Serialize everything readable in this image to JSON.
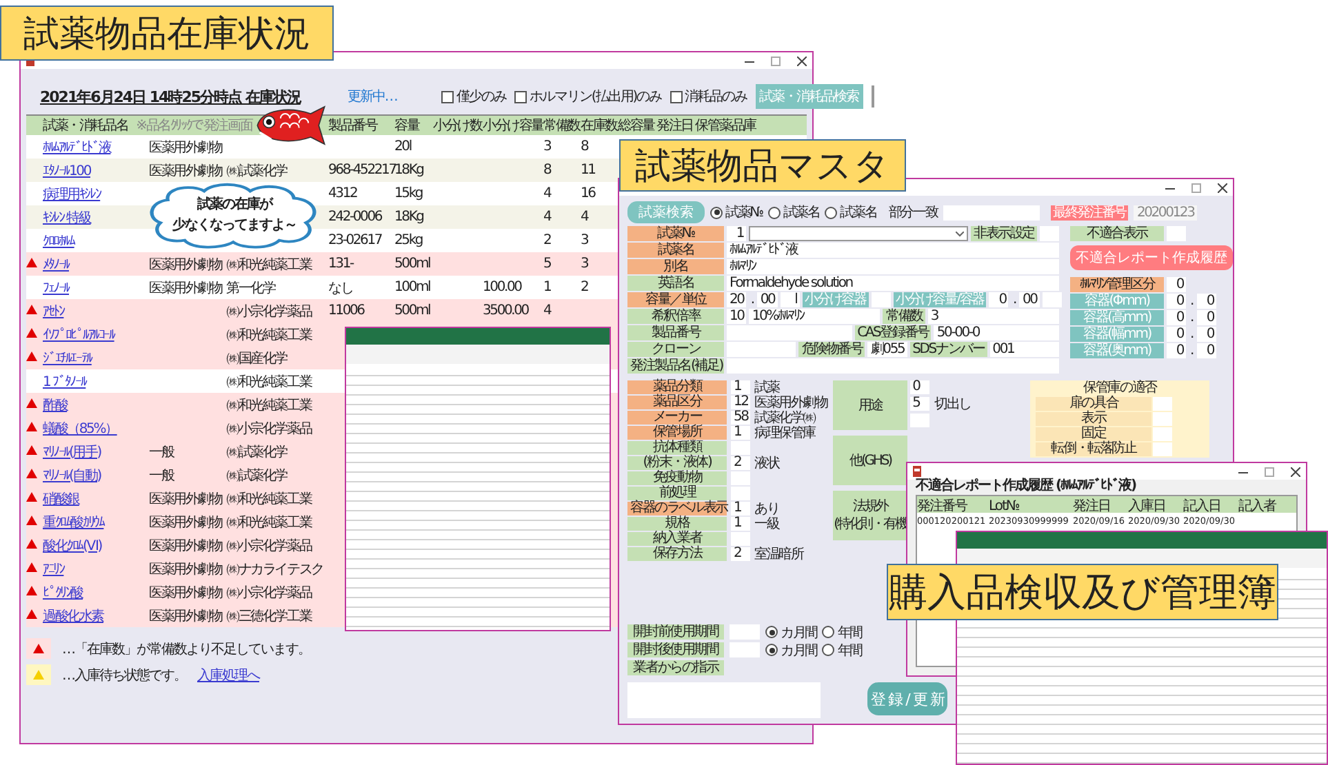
{
  "banners": [
    "試薬物品在庫状況",
    "試薬物品マスタ",
    "購入品検収及び管理簿"
  ],
  "stock_window": {
    "title": "2021年6月24日 14時25分時点 在庫状況",
    "status": "更新中…",
    "filters": [
      {
        "label": "僅少のみ",
        "checked": false
      },
      {
        "label": "ホルマリン(払出用)のみ",
        "checked": false
      },
      {
        "label": "消耗品のみ",
        "checked": false
      }
    ],
    "search_button": "試薬・消耗品検索",
    "name_header": "試薬・消耗品名",
    "name_hint": "※品名ｸﾘｯｸで発注画面",
    "columns": [
      "製品番号",
      "容量",
      "小分け数",
      "小分け容量",
      "常備数",
      "在庫数",
      "総容量",
      "発注日",
      "保管薬品庫"
    ],
    "rows": [
      {
        "warn": false,
        "name": "ﾎﾙﾑｱﾙﾃﾞﾋﾄﾞ液",
        "category": "医薬用外劇物",
        "volume": "20l",
        "standing": "3",
        "stock": "8"
      },
      {
        "warn": false,
        "name": "ｴﾀﾉｰﾙ100",
        "category": "医薬用外劇物",
        "maker": "㈱試薬化学",
        "product_no": "968-452217",
        "volume": "18Kg",
        "standing": "8",
        "stock": "11"
      },
      {
        "warn": false,
        "name": "病理用ｷｼﾚﾝ",
        "product_no": "4312",
        "volume": "15kg",
        "standing": "4",
        "stock": "16"
      },
      {
        "warn": false,
        "name": "ｷｼﾚﾝ 特級",
        "product_no": "242-0006",
        "volume": "18Kg",
        "standing": "4",
        "stock": "4"
      },
      {
        "warn": false,
        "name": "ｸﾛﾛﾎﾙﾑ",
        "product_no": "23-02617",
        "volume": "25kg",
        "standing": "2",
        "stock": "3"
      },
      {
        "warn": true,
        "name": "ﾒﾀﾉｰﾙ",
        "category": "医薬用外劇物",
        "maker": "㈱和光純薬工業",
        "product_no": "131-",
        "volume": "500ml",
        "standing": "5",
        "stock": "3"
      },
      {
        "warn": false,
        "name": "ﾌｪﾉｰﾙ",
        "category": "医薬用外劇物",
        "maker": "第一化学",
        "product_no": "なし",
        "volume": "100ml",
        "sub_volume": "100.00",
        "standing": "1",
        "stock": "2"
      },
      {
        "warn": true,
        "name": "ｱｾﾄﾝ",
        "maker": "㈱小宗化学薬品",
        "product_no": "11006",
        "volume": "500ml",
        "sub_volume": "3500.00",
        "standing": "4"
      },
      {
        "warn": true,
        "name": "ｲｿﾌﾟﾛﾋﾟﾙｱﾙｺｰﾙ",
        "maker": "㈱和光純薬工業"
      },
      {
        "warn": true,
        "name": "ｼﾞｴﾁﾙｴｰﾃﾙ",
        "maker": "㈱国産化学"
      },
      {
        "warn": false,
        "name": "1 ﾌﾞﾀﾉｰﾙ",
        "maker": "㈱和光純薬工業"
      },
      {
        "warn": true,
        "name": "酢酸",
        "maker": "㈱和光純薬工業"
      },
      {
        "warn": true,
        "name": "蟻酸（85%）",
        "maker": "㈱小宗化学薬品"
      },
      {
        "warn": true,
        "name": "ﾏﾘﾉｰﾙ(用手)",
        "category": "一般",
        "maker": "㈱試薬化学"
      },
      {
        "warn": true,
        "name": "ﾏﾘﾉｰﾙ(自動)",
        "category": "一般",
        "maker": "㈱試薬化学"
      },
      {
        "warn": true,
        "name": "硝酸銀",
        "category": "医薬用外劇物",
        "maker": "㈱和光純薬工業"
      },
      {
        "warn": true,
        "name": "重ｸﾛﾑ酸ｶﾘｳﾑ",
        "category": "医薬用外劇物",
        "maker": "㈱和光純薬工業"
      },
      {
        "warn": true,
        "name": "酸化ｸﾛﾑ(Ⅵ)",
        "category": "医薬用外劇物",
        "maker": "㈱小宗化学薬品"
      },
      {
        "warn": true,
        "name": "ｱﾆﾘﾝ",
        "category": "医薬用外劇物",
        "maker": "㈱ナカライテスク"
      },
      {
        "warn": true,
        "name": "ﾋﾟｸﾘﾝ酸",
        "category": "医薬用外劇物",
        "maker": "㈱小宗化学薬品"
      },
      {
        "warn": true,
        "name": "過酸化水素",
        "category": "医薬用外劇物",
        "maker": "㈱三徳化学工業"
      }
    ],
    "legend": [
      {
        "kind": "shortage",
        "text": "…「在庫数」が常備数より不足しています。"
      },
      {
        "kind": "waiting",
        "text": "…入庫待ち状態です。",
        "link": "入庫処理へ"
      }
    ]
  },
  "balloon": [
    "試薬の在庫が",
    "少なくなってますよ～"
  ],
  "master_window": {
    "search_button": "試薬検索",
    "search_options": [
      {
        "label": "試薬№",
        "selected": true
      },
      {
        "label": "試薬名",
        "selected": false
      },
      {
        "label": "試薬名　部分一致",
        "selected": false
      }
    ],
    "last_order_label": "最終発注番号",
    "last_order": "20200123",
    "left_rows": [
      {
        "items": [
          {
            "kind": "label",
            "text": "試薬№",
            "color": "#f4b183"
          },
          {
            "kind": "num",
            "text": "1"
          },
          {
            "kind": "dropdown"
          },
          {
            "kind": "tag",
            "text": "非表示設定",
            "color": "#c5e0b4"
          },
          {
            "kind": "num"
          }
        ]
      },
      {
        "items": [
          {
            "kind": "label",
            "text": "試薬名",
            "color": "#f4b183"
          },
          {
            "kind": "text",
            "text": "ﾎﾙﾑｱﾙﾃﾞﾋﾄﾞ液"
          }
        ]
      },
      {
        "items": [
          {
            "kind": "label",
            "text": "別名",
            "color": "#f4b183"
          },
          {
            "kind": "text",
            "text": "ﾎﾙﾏﾘﾝ"
          }
        ]
      },
      {
        "items": [
          {
            "kind": "label",
            "text": "英語名",
            "color": "#c5e0b4"
          },
          {
            "kind": "text",
            "text": "Formaldehyde solution"
          }
        ]
      },
      {
        "items": [
          {
            "kind": "label",
            "text": "容量／単位",
            "color": "#f4b183"
          },
          {
            "kind": "num",
            "text": "20"
          },
          {
            "kind": "sep",
            "text": "."
          },
          {
            "kind": "num",
            "text": "00"
          },
          {
            "kind": "num",
            "text": "l"
          },
          {
            "kind": "tag",
            "text": "小分け容器",
            "color": "#7fc4c0"
          },
          {
            "kind": "num"
          },
          {
            "kind": "tag",
            "text": "小分け容量/容器",
            "color": "#7fc4c0"
          },
          {
            "kind": "num",
            "text": "0"
          },
          {
            "kind": "sep",
            "text": "."
          },
          {
            "kind": "num",
            "text": "00"
          },
          {
            "kind": "num"
          }
        ]
      },
      {
        "items": [
          {
            "kind": "label",
            "text": "希釈倍率",
            "color": "#c5e0b4"
          },
          {
            "kind": "num",
            "text": "10"
          },
          {
            "kind": "text",
            "text": "10%ﾎﾙﾏﾘﾝ"
          },
          {
            "kind": "tag",
            "text": "常備数",
            "color": "#c5e0b4"
          },
          {
            "kind": "text",
            "text": "3"
          }
        ]
      },
      {
        "items": [
          {
            "kind": "label",
            "text": "製品番号",
            "color": "#c5e0b4"
          },
          {
            "kind": "text"
          },
          {
            "kind": "tag",
            "text": "CAS登録番号",
            "color": "#c5e0b4"
          },
          {
            "kind": "text",
            "text": "50-00-0"
          }
        ]
      },
      {
        "items": [
          {
            "kind": "label",
            "text": "クローン",
            "color": "#c5e0b4"
          },
          {
            "kind": "text"
          },
          {
            "kind": "tag",
            "text": "危険物番号",
            "color": "#c5e0b4"
          },
          {
            "kind": "num",
            "text": "劇055"
          },
          {
            "kind": "tag",
            "text": "SDSナンバー",
            "color": "#c5e0b4"
          },
          {
            "kind": "text",
            "text": "001"
          }
        ]
      },
      {
        "items": [
          {
            "kind": "label",
            "text": "発注製品名(補足)",
            "color": "#c5e0b4"
          },
          {
            "kind": "text"
          }
        ]
      }
    ],
    "right_rows": [
      {
        "items": [
          {
            "kind": "label",
            "text": "不適合表示",
            "color": "#c5e0b4"
          },
          {
            "kind": "num"
          }
        ]
      },
      {
        "items": [
          {
            "kind": "button",
            "text": "不適合レポート作成履歴",
            "color": "#ff7c80"
          }
        ]
      },
      {
        "items": [
          {
            "kind": "label",
            "text": "ﾎﾙﾏﾘﾝ管理区分",
            "color": "#f4b183"
          },
          {
            "kind": "num",
            "text": "0"
          }
        ]
      },
      {
        "items": [
          {
            "kind": "label",
            "text": "容器(Φmm)",
            "color": "#7fc4c0"
          },
          {
            "kind": "num",
            "text": "0"
          },
          {
            "kind": "sep",
            "text": "."
          },
          {
            "kind": "num",
            "text": "0"
          }
        ]
      },
      {
        "items": [
          {
            "kind": "label",
            "text": "容器(高mm)",
            "color": "#7fc4c0"
          },
          {
            "kind": "num",
            "text": "0"
          },
          {
            "kind": "sep",
            "text": "."
          },
          {
            "kind": "num",
            "text": "0"
          }
        ]
      },
      {
        "items": [
          {
            "kind": "label",
            "text": "容器(幅mm)",
            "color": "#7fc4c0"
          },
          {
            "kind": "num",
            "text": "0"
          },
          {
            "kind": "sep",
            "text": "."
          },
          {
            "kind": "num",
            "text": "0"
          }
        ]
      },
      {
        "items": [
          {
            "kind": "label",
            "text": "容器(奥mm)",
            "color": "#7fc4c0"
          },
          {
            "kind": "num",
            "text": "0"
          },
          {
            "kind": "sep",
            "text": "."
          },
          {
            "kind": "num",
            "text": "0"
          }
        ]
      }
    ],
    "attributes": [
      {
        "label": "薬品分類",
        "color": "#f4b183",
        "code": "1",
        "text": "試薬"
      },
      {
        "label": "薬品区分",
        "color": "#f4b183",
        "code": "12",
        "text": "医薬用外劇物"
      },
      {
        "label": "メーカー",
        "color": "#f4b183",
        "code": "58",
        "text": "試薬化学㈱"
      },
      {
        "label": "保管場所",
        "color": "#f4b183",
        "code": "1",
        "text": "病理保管庫"
      },
      {
        "label": "抗体種類",
        "color": "#c5e0b4"
      },
      {
        "label": "(粉末・液体)",
        "color": "#c5e0b4",
        "code": "2",
        "text": "液状"
      },
      {
        "label": "免疫動物",
        "color": "#c5e0b4"
      },
      {
        "label": "前処理",
        "color": "#c5e0b4"
      },
      {
        "label": "容器のラベル表示",
        "color": "#f4b183",
        "code": "1",
        "text": "あり"
      },
      {
        "label": "規格",
        "color": "#c5e0b4",
        "code": "1",
        "text": "一級"
      },
      {
        "label": "納入業者",
        "color": "#c5e0b4"
      },
      {
        "label": "保存方法",
        "color": "#c5e0b4",
        "code": "2",
        "text": "室温暗所"
      }
    ],
    "groups": [
      {
        "lines": [
          "用途"
        ],
        "slots": [
          {
            "kind": "box",
            "code": "0"
          },
          {
            "kind": "box",
            "code": "5",
            "text": "切出し"
          },
          {
            "kind": "box"
          }
        ]
      },
      {
        "lines": [
          "他(GHS)"
        ]
      },
      {
        "lines": [
          "法規外",
          "(特化則・有機"
        ]
      }
    ],
    "storage_check": {
      "title": "保管庫の適否",
      "items": [
        "扉の具合",
        "表示",
        "固定",
        "転倒・転落防止"
      ]
    },
    "periods": [
      {
        "label": "開封前使用期間",
        "options": [
          {
            "label": "カ月間",
            "selected": true
          },
          {
            "label": "年間",
            "selected": false
          }
        ]
      },
      {
        "label": "開封後使用期間",
        "options": [
          {
            "label": "カ月間",
            "selected": true
          },
          {
            "label": "年間",
            "selected": false
          }
        ]
      }
    ],
    "instructions_label": "業者からの指示",
    "submit": "登 録 / 更 新"
  },
  "report_window": {
    "heading": "不適合レポート作成履歴 (ﾎﾙﾑｱﾙﾃﾞﾋﾄﾞ液)",
    "columns": [
      "発注番号",
      "Lot№",
      "発注日",
      "入庫日",
      "記入日",
      "記入者"
    ],
    "rows": [
      [
        "000120200121",
        "20230930999999",
        "2020/09/16",
        "2020/09/30",
        "2020/09/30"
      ]
    ]
  }
}
